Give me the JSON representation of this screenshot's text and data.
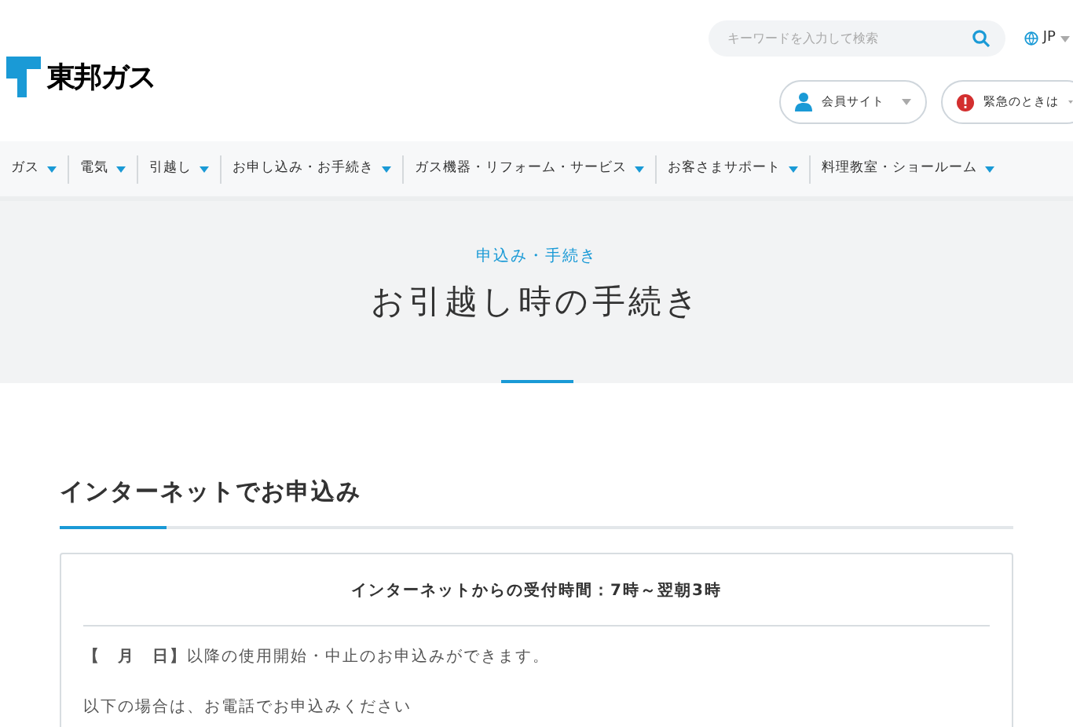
{
  "header": {
    "logo_text": "東邦ガス",
    "search": {
      "placeholder": "キーワードを入力して検索"
    },
    "language": "JP",
    "buttons": [
      {
        "kind": "member",
        "label": "会員サイト"
      },
      {
        "kind": "emergency",
        "label": "緊急のときは"
      }
    ]
  },
  "nav": [
    "ガス",
    "電気",
    "引越し",
    "お申し込み・お手続き",
    "ガス機器・リフォーム・サービス",
    "お客さまサポート",
    "料理教室・ショールーム"
  ],
  "hero": {
    "category": "申込み・手続き",
    "title": "お引越し時の手続き"
  },
  "section": {
    "heading": "インターネットでお申込み",
    "card": {
      "title": "インターネットからの受付時間：7時～翌朝3時",
      "paragraphs": [
        "**【　月　日】**以降の使用開始・中止のお申込みができます。",
        "以下の場合は、お電話でお申込みください"
      ]
    }
  }
}
